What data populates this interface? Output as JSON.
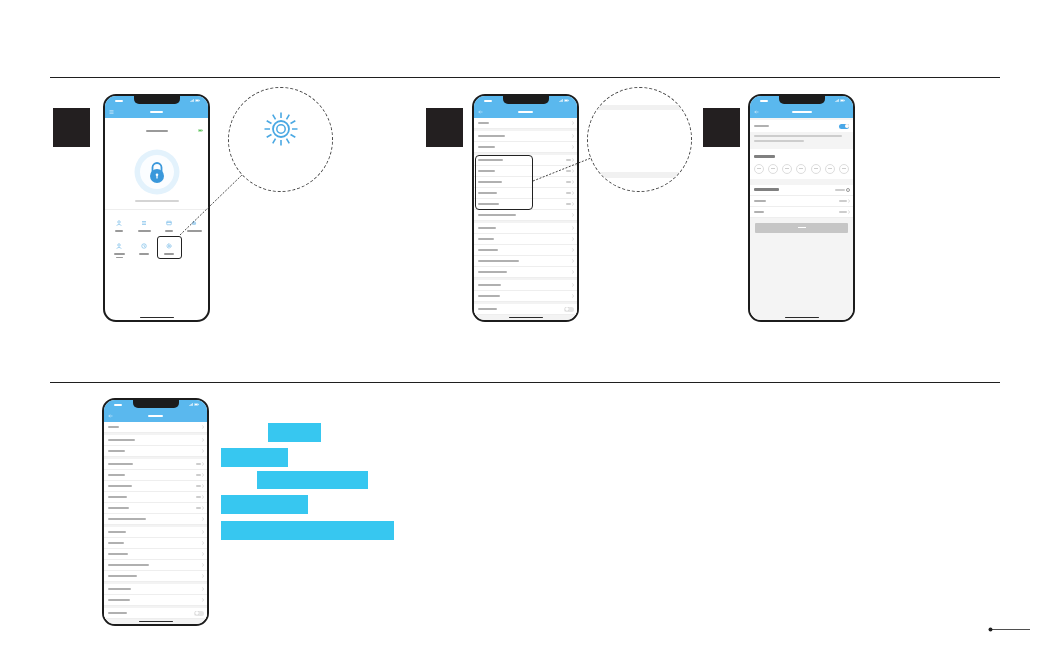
{
  "sections": [
    {
      "panels": [
        {
          "kind": "home",
          "phone": {
            "features": [
              {
                "kind": "ekeys",
                "highlighted": false
              },
              {
                "kind": "passcodes",
                "highlighted": false
              },
              {
                "kind": "cards",
                "highlighted": false
              },
              {
                "kind": "fingerprints",
                "highlighted": false
              },
              {
                "kind": "admin",
                "highlighted": false
              },
              {
                "kind": "records",
                "highlighted": false
              },
              {
                "kind": "settings",
                "highlighted": true
              }
            ]
          },
          "callout": {
            "kind": "icon"
          }
        },
        {
          "kind": "settings",
          "phone": {
            "groups": [
              {
                "rows": [
                  {
                    "kind": "link",
                    "highlighted": false
                  }
                ]
              },
              {
                "rows": [
                  {
                    "kind": "link",
                    "highlighted": false
                  },
                  {
                    "kind": "link",
                    "highlighted": false
                  }
                ]
              },
              {
                "rows": [
                  {
                    "kind": "value",
                    "highlighted": true
                  },
                  {
                    "kind": "value",
                    "highlighted": true
                  },
                  {
                    "kind": "value",
                    "highlighted": true
                  },
                  {
                    "kind": "value",
                    "highlighted": true
                  },
                  {
                    "kind": "value",
                    "highlighted": true
                  },
                  {
                    "kind": "link",
                    "highlighted": false
                  }
                ]
              },
              {
                "rows": [
                  {
                    "kind": "link",
                    "highlighted": false
                  },
                  {
                    "kind": "link",
                    "highlighted": false
                  },
                  {
                    "kind": "link",
                    "highlighted": false
                  },
                  {
                    "kind": "link",
                    "highlighted": false
                  },
                  {
                    "kind": "link",
                    "highlighted": false
                  }
                ]
              },
              {
                "rows": [
                  {
                    "kind": "link",
                    "highlighted": false
                  },
                  {
                    "kind": "link",
                    "highlighted": false
                  }
                ]
              },
              {
                "rows": [
                  {
                    "kind": "toggle",
                    "on": false,
                    "highlighted": false
                  }
                ]
              }
            ]
          },
          "callout": {
            "kind": "blank"
          }
        },
        {
          "kind": "passage",
          "phone": {
            "mode_row": {
              "on": true
            },
            "days": [
              {
                "selected": false
              },
              {
                "selected": false
              },
              {
                "selected": false
              },
              {
                "selected": false
              },
              {
                "selected": false
              },
              {
                "selected": false
              },
              {
                "selected": false
              }
            ],
            "all_hours": {
              "checked": false
            },
            "save_button": {
              "disabled": true
            }
          }
        }
      ]
    },
    {
      "panels": [
        {
          "kind": "settings",
          "phone": {
            "groups": [
              {
                "rows": [
                  {
                    "kind": "link",
                    "highlighted": false
                  }
                ]
              },
              {
                "rows": [
                  {
                    "kind": "link",
                    "highlighted": false
                  },
                  {
                    "kind": "link",
                    "highlighted": false
                  }
                ]
              },
              {
                "rows": [
                  {
                    "kind": "value",
                    "highlighted": false
                  },
                  {
                    "kind": "value",
                    "highlighted": false
                  },
                  {
                    "kind": "value",
                    "highlighted": false
                  },
                  {
                    "kind": "value",
                    "highlighted": false
                  },
                  {
                    "kind": "value",
                    "highlighted": false
                  },
                  {
                    "kind": "link",
                    "highlighted": false
                  }
                ]
              },
              {
                "rows": [
                  {
                    "kind": "link",
                    "highlighted": false
                  },
                  {
                    "kind": "link",
                    "highlighted": false
                  },
                  {
                    "kind": "link",
                    "highlighted": false
                  },
                  {
                    "kind": "link",
                    "highlighted": false
                  },
                  {
                    "kind": "link",
                    "highlighted": false
                  }
                ]
              },
              {
                "rows": [
                  {
                    "kind": "link",
                    "highlighted": false
                  },
                  {
                    "kind": "link",
                    "highlighted": false
                  }
                ]
              },
              {
                "rows": [
                  {
                    "kind": "toggle",
                    "on": false,
                    "highlighted": false
                  }
                ]
              }
            ]
          }
        }
      ]
    }
  ]
}
